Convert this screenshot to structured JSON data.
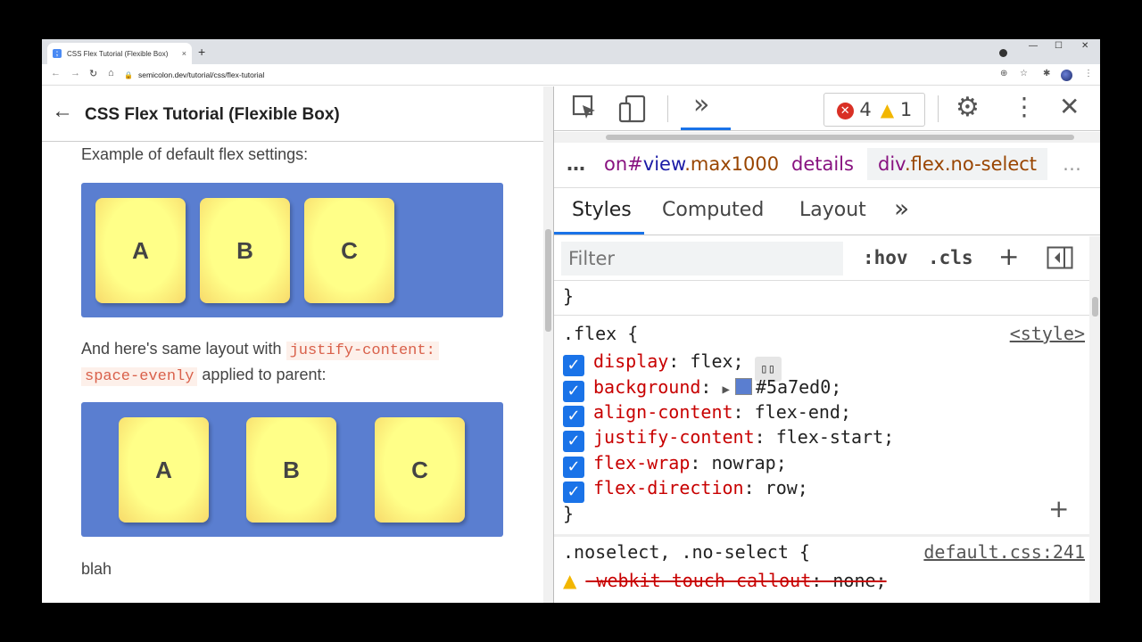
{
  "browser": {
    "tab_title": "CSS Flex Tutorial (Flexible Box)",
    "tab_close": "×",
    "new_tab": "+",
    "url": "semicolon.dev/tutorial/css/flex-tutorial",
    "controls": {
      "minimize": "—",
      "maximize": "☐",
      "close": "✕"
    }
  },
  "page": {
    "back_arrow": "←",
    "title": "CSS Flex Tutorial (Flexible Box)",
    "intro": "Example of default flex settings:",
    "example1_items": [
      "A",
      "B",
      "C"
    ],
    "mid_text_before": "And here's same layout with ",
    "mid_code_1": "justify-content:",
    "mid_code_2": "space-evenly",
    "mid_text_after": " applied to parent:",
    "example2_items": [
      "A",
      "B",
      "C"
    ],
    "footer_text": "blah",
    "flex_bg_color": "#5a7ed0"
  },
  "devtools": {
    "more_tabs": "»",
    "error_count": "4",
    "warning_count": "1",
    "breadcrumbs": {
      "ellipsis_left": "…",
      "crumb1_prefix": "on#",
      "crumb1_id": "view",
      "crumb1_class": ".max1000",
      "crumb2": "details",
      "crumb3_tag": "div",
      "crumb3_class": ".flex.no-select",
      "ellipsis_right": "…"
    },
    "subtabs": [
      "Styles",
      "Computed",
      "Layout"
    ],
    "subtab_more": "»",
    "filter_placeholder": "Filter",
    "hov": ":hov",
    "cls": ".cls",
    "add": "+",
    "close_brace": "}",
    "rule1": {
      "selector": ".flex",
      "open": "{",
      "source": "<style>",
      "declarations": [
        {
          "prop": "display",
          "value": "flex;"
        },
        {
          "prop": "background",
          "value": "#5a7ed0;"
        },
        {
          "prop": "align-content",
          "value": "flex-end;"
        },
        {
          "prop": "justify-content",
          "value": "flex-start;"
        },
        {
          "prop": "flex-wrap",
          "value": "nowrap;"
        },
        {
          "prop": "flex-direction",
          "value": "row;"
        }
      ],
      "close": "}",
      "add": "+"
    },
    "rule2": {
      "selector": ".noselect, .no-select",
      "open": "{",
      "source": "default.css:241",
      "decl_prop": "-webkit-touch-callout",
      "decl_value": "none;"
    }
  }
}
